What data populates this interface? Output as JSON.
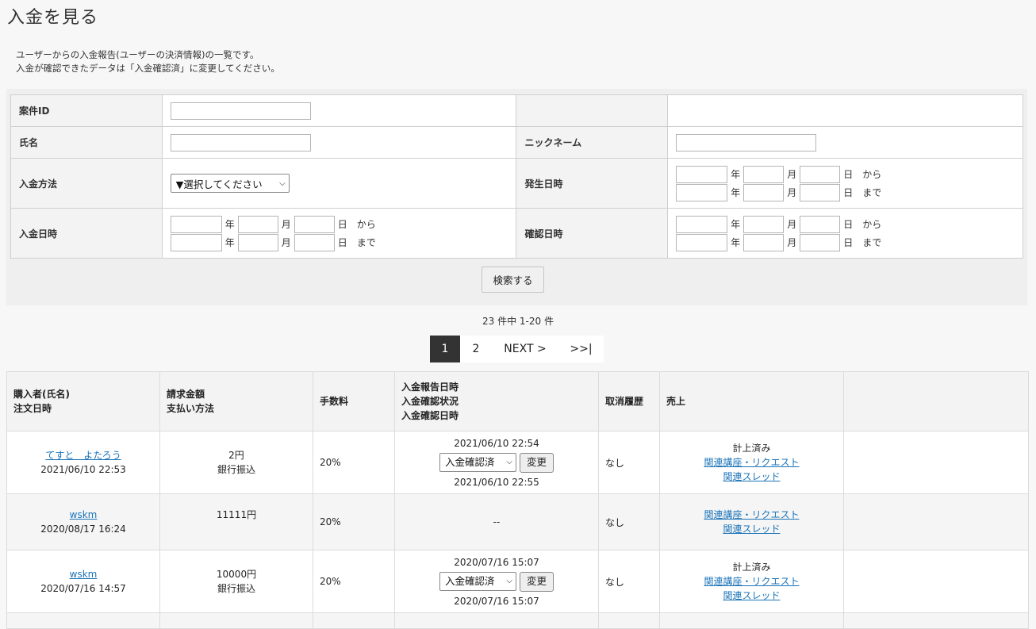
{
  "page": {
    "title": "入金を見る",
    "description": [
      "ユーザーからの入金報告(ユーザーの決済情報)の一覧です。",
      "入金が確認できたデータは「入金確認済」に変更してください。"
    ]
  },
  "search": {
    "labels": {
      "case_id": "案件ID",
      "name": "氏名",
      "nickname": "ニックネーム",
      "payment_method": "入金方法",
      "occurred_at": "発生日時",
      "paid_at": "入金日時",
      "confirmed_at": "確認日時"
    },
    "payment_method_selected": "▼選択してください",
    "units": {
      "year": "年",
      "month": "月",
      "day": "日",
      "from": "から",
      "to": "まで"
    },
    "submit_label": "検索する"
  },
  "result_count": "23 件中 1-20 件",
  "pager": {
    "pages": [
      "1",
      "2"
    ],
    "current": "1",
    "next": "NEXT >",
    "last": ">>|"
  },
  "table": {
    "headers": {
      "buyer": [
        "購入者(氏名)",
        "注文日時"
      ],
      "amount": [
        "請求金額",
        "支払い方法"
      ],
      "fee": "手数料",
      "report": [
        "入金報告日時",
        "入金確認状況",
        "入金確認日時"
      ],
      "cancel": "取消履歴",
      "sales": "売上"
    },
    "rows": [
      {
        "buyer": "てすと　よたろう",
        "order_date": "2021/06/10 22:53",
        "amount": "2円",
        "method": "銀行振込",
        "fee": "20%",
        "reported_at": "2021/06/10 22:54",
        "status": "入金確認済",
        "change_label": "変更",
        "confirmed_at": "2021/06/10 22:55",
        "cancel": "なし",
        "sales_status": "計上済み",
        "link1": "関連講座・リクエスト",
        "link2": "関連スレッド"
      },
      {
        "buyer": "wskm",
        "order_date": "2020/08/17 16:24",
        "amount": "11111円",
        "method": "",
        "fee": "20%",
        "report_placeholder": "--",
        "cancel": "なし",
        "link1": "関連講座・リクエスト",
        "link2": "関連スレッド"
      },
      {
        "buyer": "wskm",
        "order_date": "2020/07/16 14:57",
        "amount": "10000円",
        "method": "銀行振込",
        "fee": "20%",
        "reported_at": "2020/07/16 15:07",
        "status": "入金確認済",
        "change_label": "変更",
        "confirmed_at": "2020/07/16 15:07",
        "cancel": "なし",
        "sales_status": "計上済み",
        "link1": "関連講座・リクエスト",
        "link2": "関連スレッド"
      }
    ]
  }
}
